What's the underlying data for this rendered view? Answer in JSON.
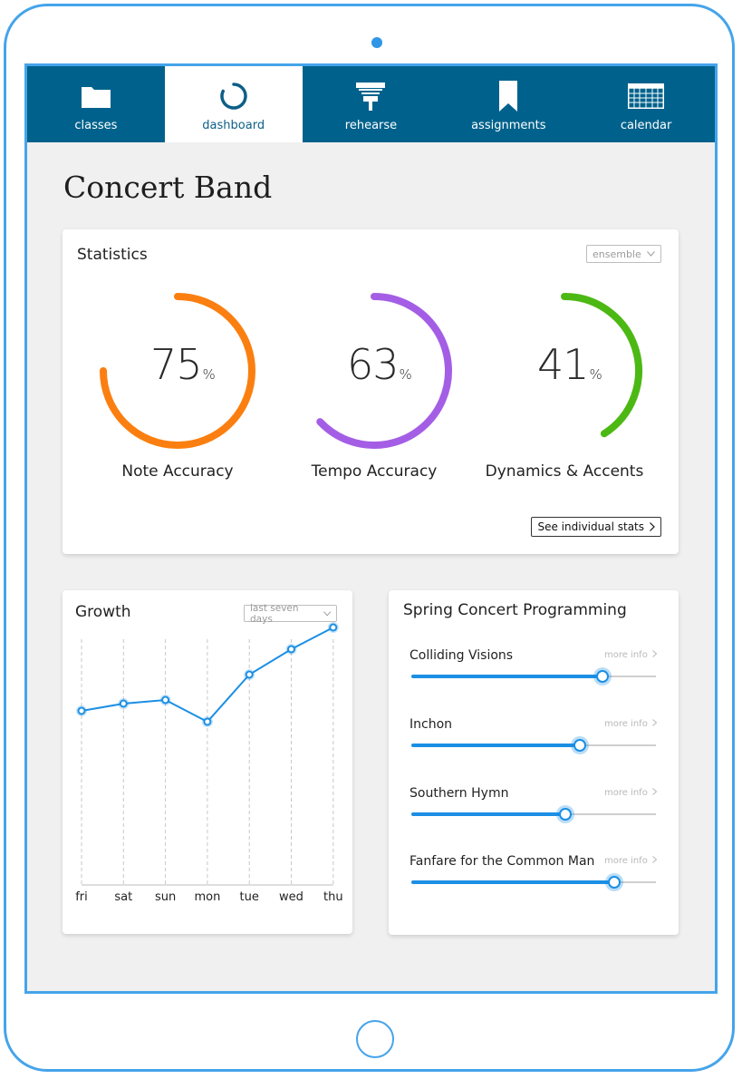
{
  "nav": {
    "items": [
      {
        "label": "classes",
        "icon": "folder-icon"
      },
      {
        "label": "dashboard",
        "icon": "dashboard-ring-icon"
      },
      {
        "label": "rehearse",
        "icon": "music-stand-icon"
      },
      {
        "label": "assignments",
        "icon": "bookmark-icon"
      },
      {
        "label": "calendar",
        "icon": "calendar-icon"
      }
    ],
    "active": "dashboard"
  },
  "page_title": "Concert Band",
  "statistics": {
    "title": "Statistics",
    "dropdown_value": "ensemble",
    "gauges": [
      {
        "value": 75,
        "unit": "%",
        "label": "Note Accuracy",
        "color": "#fb7f10"
      },
      {
        "value": 63,
        "unit": "%",
        "label": "Tempo Accuracy",
        "color": "#a45ee5"
      },
      {
        "value": 41,
        "unit": "%",
        "label": "Dynamics & Accents",
        "color": "#4cb814"
      }
    ],
    "button_label": "See individual stats"
  },
  "growth": {
    "title": "Growth",
    "dropdown_value": "last seven days"
  },
  "chart_data": {
    "type": "line",
    "categories": [
      "fri",
      "sat",
      "sun",
      "mon",
      "tue",
      "wed",
      "thu"
    ],
    "values": [
      63,
      65,
      66,
      60,
      73,
      80,
      86
    ],
    "ylim": [
      0,
      100
    ],
    "grid": "vertical dashed",
    "color": "#1b8fe4"
  },
  "programming": {
    "title": "Spring Concert Programming",
    "more_label": "more info",
    "items": [
      {
        "name": "Colliding Visions",
        "progress": 0.78
      },
      {
        "name": "Inchon",
        "progress": 0.69
      },
      {
        "name": "Southern Hymn",
        "progress": 0.63
      },
      {
        "name": "Fanfare for the Common Man",
        "progress": 0.83
      }
    ]
  },
  "colors": {
    "nav_bg": "#00628c",
    "accent": "#1b8fe4",
    "device_frame": "#45a4ea"
  }
}
